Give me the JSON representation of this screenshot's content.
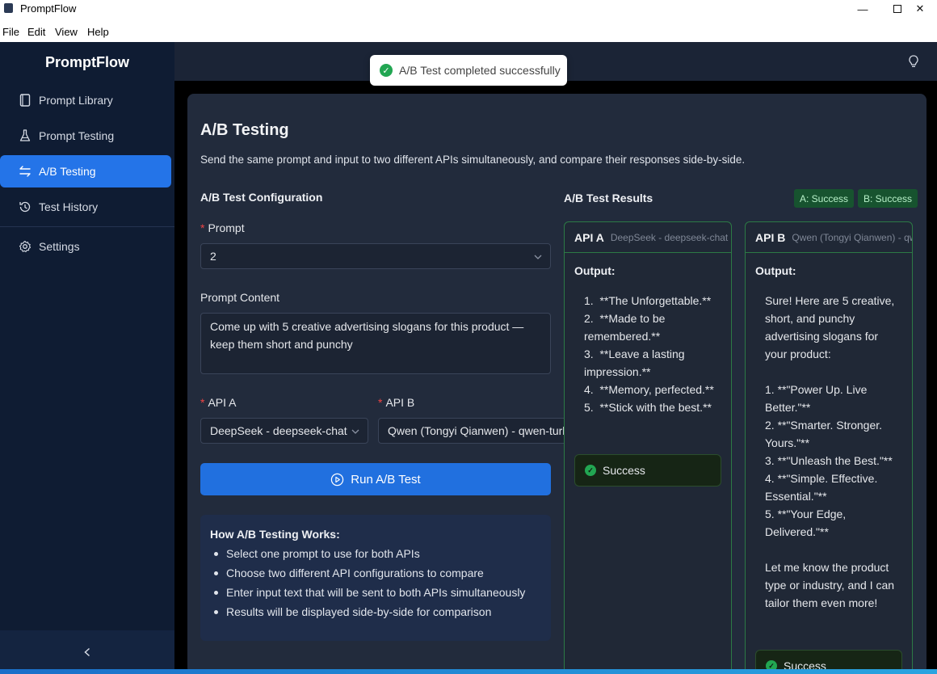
{
  "window": {
    "title": "PromptFlow",
    "minimize": "—",
    "close": "✕"
  },
  "menu": [
    "File",
    "Edit",
    "View",
    "Help"
  ],
  "sidebar": {
    "brand": "PromptFlow",
    "items": [
      {
        "label": "Prompt Library",
        "icon": "book-icon"
      },
      {
        "label": "Prompt Testing",
        "icon": "flask-icon"
      },
      {
        "label": "A/B Testing",
        "icon": "swap-icon",
        "active": true
      },
      {
        "label": "Test History",
        "icon": "history-icon"
      },
      {
        "label": "Settings",
        "icon": "gear-icon"
      }
    ],
    "collapse": "‹"
  },
  "toast": {
    "message": "A/B Test completed successfully",
    "icon": "check-circle-icon"
  },
  "page": {
    "title": "A/B Testing",
    "description": "Send the same prompt and input to two different APIs simultaneously, and compare their responses side-by-side."
  },
  "config": {
    "title": "A/B Test Configuration",
    "prompt_label": "Prompt",
    "prompt_value": "2",
    "content_label": "Prompt Content",
    "content_value": "Come up with 5 creative advertising slogans for this product — keep them short and punchy",
    "api_a_label": "API A",
    "api_a_value": "DeepSeek - deepseek-chat",
    "api_b_label": "API B",
    "api_b_value": "Qwen (Tongyi Qianwen) - qwen-turbo",
    "run_button": "Run A/B Test"
  },
  "how": {
    "title": "How A/B Testing Works:",
    "items": [
      "Select one prompt to use for both APIs",
      "Choose two different API configurations to compare",
      "Enter input text that will be sent to both APIs simultaneously",
      "Results will be displayed side-by-side for comparison"
    ]
  },
  "results": {
    "title": "A/B Test Results",
    "badge_a": "A: Success",
    "badge_b": "B: Success",
    "output_label": "Output:",
    "a": {
      "api": "API A",
      "model": "DeepSeek - deepseek-chat",
      "output": "1.  **The Unforgettable.**\n2.  **Made to be remembered.**\n3.  **Leave a lasting impression.**\n4.  **Memory, perfected.**\n5.  **Stick with the best.**",
      "status": "Success"
    },
    "b": {
      "api": "API B",
      "model": "Qwen (Tongyi Qianwen) - qwen-turbo",
      "output": "Sure! Here are 5 creative, short, and punchy advertising slogans for your product:\n\n1. **\"Power Up. Live Better.\"**\n2. **\"Smarter. Stronger. Yours.\"**\n3. **\"Unleash the Best.\"**\n4. **\"Simple. Effective. Essential.\"**\n5. **\"Your Edge, Delivered.\"**\n\nLet me know the product type or industry, and I can tailor them even more!",
      "status": "Success"
    }
  },
  "colors": {
    "accent": "#2474e8",
    "success": "#22a652",
    "sidebar": "#0f1c33",
    "card": "#222b3c"
  }
}
